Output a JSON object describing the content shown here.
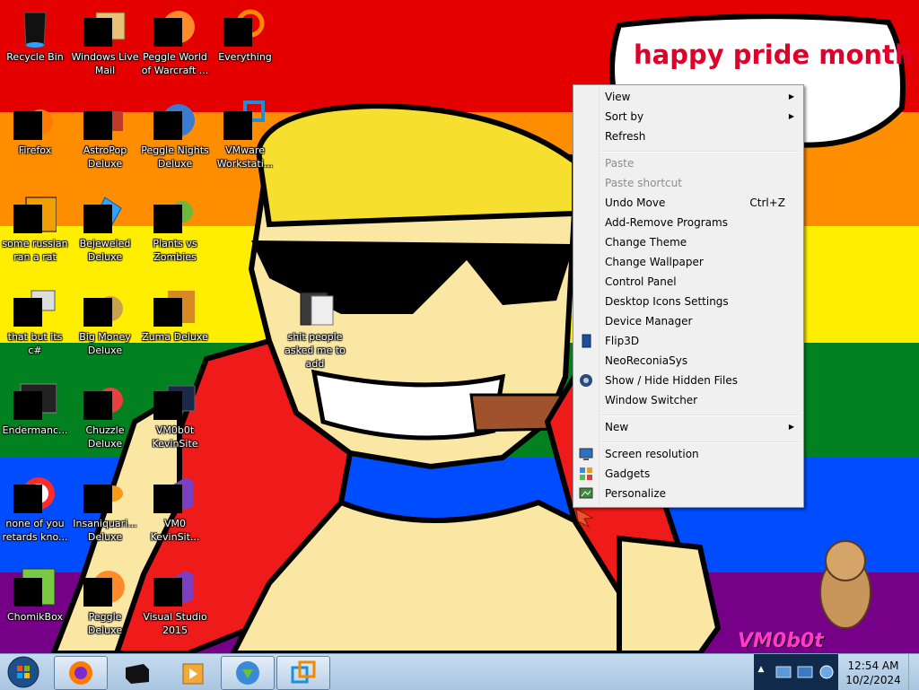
{
  "desktop": {
    "bubble_text": "happy pride month",
    "signature": "VM0b0t",
    "icons": [
      {
        "label": "Recycle Bin"
      },
      {
        "label": "Windows Live Mail"
      },
      {
        "label": "Peggle World of Warcraft ..."
      },
      {
        "label": "Everything"
      },
      {
        "label": "Firefox"
      },
      {
        "label": "AstroPop Deluxe"
      },
      {
        "label": "Peggle Nights Deluxe"
      },
      {
        "label": "VMware Workstati..."
      },
      {
        "label": "some russian ran a rat"
      },
      {
        "label": "Bejeweled Deluxe"
      },
      {
        "label": "Plants vs Zombies"
      },
      {
        "label": "that but its c#"
      },
      {
        "label": "Big Money Deluxe"
      },
      {
        "label": "Zuma Deluxe"
      },
      {
        "label": "Endermanc..."
      },
      {
        "label": "Chuzzle Deluxe"
      },
      {
        "label": "VM0b0t KevinSite"
      },
      {
        "label": "none of you retards kno..."
      },
      {
        "label": "Insaniquari... Deluxe"
      },
      {
        "label": "VM0 KevinSit..."
      },
      {
        "label": "ChomikBox"
      },
      {
        "label": "Peggle Deluxe"
      },
      {
        "label": "Visual Studio 2015"
      },
      {
        "label": "shit people asked me to add"
      }
    ]
  },
  "context_menu": {
    "items": [
      {
        "label": "View",
        "submenu": true
      },
      {
        "label": "Sort by",
        "submenu": true
      },
      {
        "label": "Refresh"
      },
      {
        "label": "Paste",
        "disabled": true
      },
      {
        "label": "Paste shortcut",
        "disabled": true
      },
      {
        "label": "Undo Move",
        "shortcut": "Ctrl+Z"
      },
      {
        "label": "Add-Remove Programs"
      },
      {
        "label": "Change Theme"
      },
      {
        "label": "Change Wallpaper"
      },
      {
        "label": "Control Panel"
      },
      {
        "label": "Desktop Icons Settings"
      },
      {
        "label": "Device Manager"
      },
      {
        "label": "Flip3D",
        "icon": "flip3d-icon"
      },
      {
        "label": "NeoReconiaSys"
      },
      {
        "label": "Show / Hide Hidden Files",
        "icon": "hidden-files-icon"
      },
      {
        "label": "Window Switcher"
      },
      {
        "label": "New",
        "submenu": true
      },
      {
        "label": "Screen resolution",
        "icon": "monitor-icon"
      },
      {
        "label": "Gadgets",
        "icon": "gadgets-icon"
      },
      {
        "label": "Personalize",
        "icon": "personalize-icon"
      }
    ]
  },
  "taskbar": {
    "start": "start-orb-icon",
    "pinned": [
      "firefox-icon",
      "terminal-icon",
      "media-player-icon",
      "internet-download-manager-icon",
      "vmware-icon"
    ],
    "clock_time": "12:54 AM",
    "clock_date": "10/2/2024"
  },
  "colors": {
    "pride": [
      "#e50000",
      "#ff8d00",
      "#ffee00",
      "#028121",
      "#004cff",
      "#770088"
    ],
    "bubble_text": "#e0002a",
    "menu_bg": "#f0f0f0"
  }
}
